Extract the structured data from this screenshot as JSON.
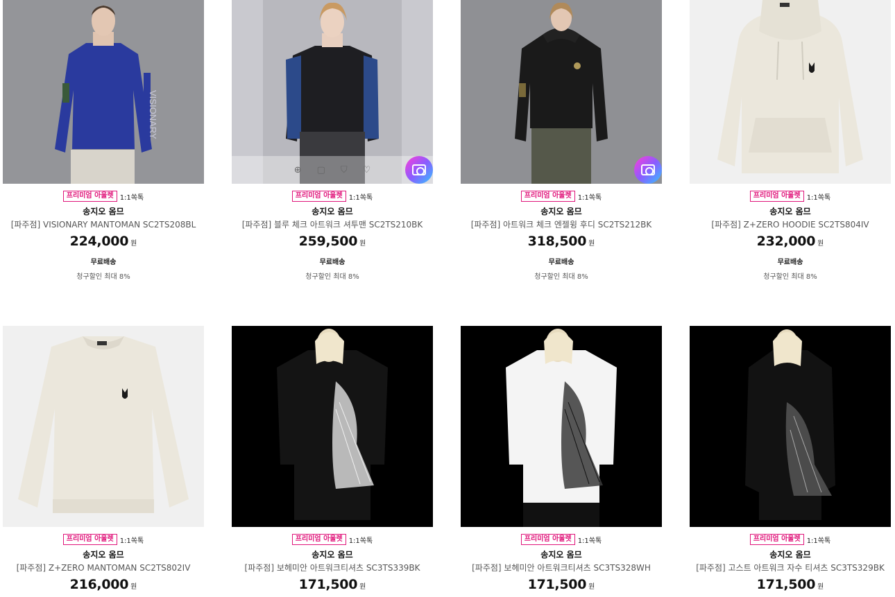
{
  "products": [
    {
      "badge": "프리미엄 아울렛",
      "talk": "1:1쏙톡",
      "brand": "송지오 옴므",
      "name": "[파주점] VISIONARY MANTOMAN SC2TS208BL",
      "price": "224,000",
      "currency": "원",
      "shipping": "무료배송",
      "discount": "청구할인 최대 8%",
      "image_icon": "model-blue-sweatshirt"
    },
    {
      "badge": "프리미엄 아울렛",
      "talk": "1:1쏙톡",
      "brand": "송지오 옴므",
      "name": "[파주점] 블루 체크 아트워크 셔투맨 SC2TS210BK",
      "price": "259,500",
      "currency": "원",
      "shipping": "무료배송",
      "discount": "청구할인 최대 8%",
      "image_icon": "model-check-sleeve-sweatshirt"
    },
    {
      "badge": "프리미엄 아울렛",
      "talk": "1:1쏙톡",
      "brand": "송지오 옴므",
      "name": "[파주점] 아트워크 체크 엔젤윙 후디 SC2TS212BK",
      "price": "318,500",
      "currency": "원",
      "shipping": "무료배송",
      "discount": "청구할인 최대 8%",
      "image_icon": "model-black-hoodie"
    },
    {
      "badge": "프리미엄 아울렛",
      "talk": "1:1쏙톡",
      "brand": "송지오 옴므",
      "name": "[파주점] Z+ZERO HOODIE SC2TS804IV",
      "price": "232,000",
      "currency": "원",
      "shipping": "무료배송",
      "discount": "청구할인 최대 8%",
      "image_icon": "ivory-hoodie"
    },
    {
      "badge": "프리미엄 아울렛",
      "talk": "1:1쏙톡",
      "brand": "송지오 옴므",
      "name": "[파주점] Z+ZERO MANTOMAN SC2TS802IV",
      "price": "216,000",
      "currency": "원",
      "image_icon": "ivory-sweatshirt"
    },
    {
      "badge": "프리미엄 아울렛",
      "talk": "1:1쏙톡",
      "brand": "송지오 옴므",
      "name": "[파주점] 보헤미안 아트워크티셔츠 SC3TS339BK",
      "price": "171,500",
      "currency": "원",
      "image_icon": "model-black-artwork-tee"
    },
    {
      "badge": "프리미엄 아울렛",
      "talk": "1:1쏙톡",
      "brand": "송지오 옴므",
      "name": "[파주점] 보헤미안 아트워크티셔츠 SC3TS328WH",
      "price": "171,500",
      "currency": "원",
      "image_icon": "model-white-artwork-tee"
    },
    {
      "badge": "프리미엄 아울렛",
      "talk": "1:1쏙톡",
      "brand": "송지오 옴므",
      "name": "[파주점] 고스트 아트워크 자수 티셔츠 SC3TS329BK",
      "price": "171,500",
      "currency": "원",
      "image_icon": "model-black-ghost-tee"
    }
  ],
  "colors": {
    "badge": "#e0147a"
  }
}
